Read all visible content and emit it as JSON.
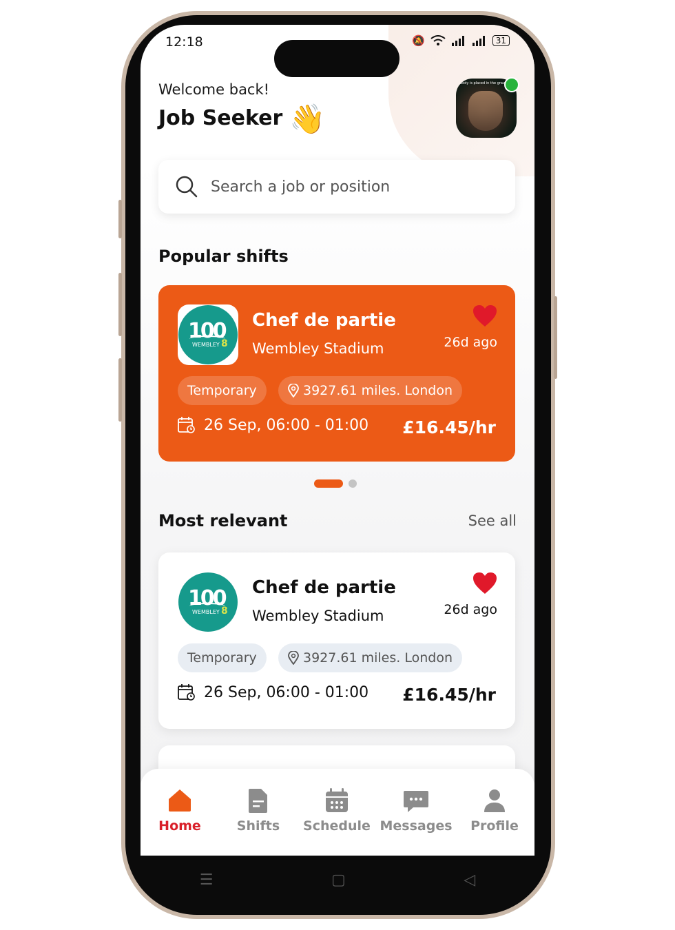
{
  "status_bar": {
    "time": "12:18",
    "battery": "31"
  },
  "header": {
    "welcome": "Welcome back!",
    "username": "Job Seeker",
    "wave_emoji": "👋",
    "avatar_caption": "body is placed in the grave"
  },
  "search": {
    "placeholder": "Search a job or position"
  },
  "popular": {
    "title": "Popular shifts",
    "card": {
      "job_title": "Chef de partie",
      "company": "Wembley Stadium",
      "posted": "26d ago",
      "type": "Temporary",
      "location": "3927.61 miles. London",
      "datetime": "26 Sep, 06:00 - 01:00",
      "rate": "£16.45/hr",
      "logo_text": "100",
      "logo_sub": "WEMBLEY"
    },
    "pagination": {
      "pages": 2,
      "active": 1
    }
  },
  "relevant": {
    "title": "Most relevant",
    "see_all": "See all",
    "card": {
      "job_title": "Chef de partie",
      "company": "Wembley Stadium",
      "posted": "26d ago",
      "type": "Temporary",
      "location": "3927.61 miles. London",
      "datetime": "26 Sep, 06:00 - 01:00",
      "rate": "£16.45/hr",
      "logo_text": "100",
      "logo_sub": "WEMBLEY"
    }
  },
  "tabs": [
    {
      "label": "Home",
      "icon": "home-icon",
      "active": true
    },
    {
      "label": "Shifts",
      "icon": "document-icon",
      "active": false
    },
    {
      "label": "Schedule",
      "icon": "calendar-icon",
      "active": false
    },
    {
      "label": "Messages",
      "icon": "chat-icon",
      "active": false
    },
    {
      "label": "Profile",
      "icon": "user-icon",
      "active": false
    }
  ],
  "colors": {
    "accent": "#ec5a16",
    "active_tab": "#d9202a",
    "heart": "#e0192a",
    "logo_teal": "#169a8c"
  }
}
